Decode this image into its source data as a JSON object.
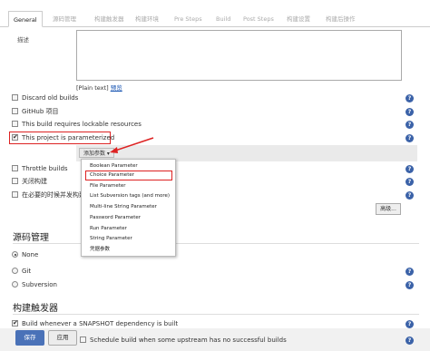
{
  "tabs": [
    "General",
    "源码管理",
    "构建触发器",
    "构建环境",
    "Pre Steps",
    "Build",
    "Post Steps",
    "构建设置",
    "构建后操作"
  ],
  "description": {
    "label": "描述",
    "preview": "[Plain text]",
    "preview_link": "预览"
  },
  "options": [
    {
      "label": "Discard old builds",
      "checked": false
    },
    {
      "label": "GitHub 项目",
      "checked": false
    },
    {
      "label": "This build requires lockable resources",
      "checked": false
    },
    {
      "label": "This project is parameterized",
      "checked": true
    },
    {
      "label": "Throttle builds",
      "checked": false
    },
    {
      "label": "关闭构建",
      "checked": false
    },
    {
      "label": "在必要的时候并发构建",
      "checked": false
    }
  ],
  "add_param_button": "添加参数",
  "param_menu": [
    "Boolean Parameter",
    "Choice Parameter",
    "File Parameter",
    "List Subversion tags (and more)",
    "Multi-line String Parameter",
    "Password Parameter",
    "Run Parameter",
    "String Parameter",
    "凭据参数"
  ],
  "advanced_button": "高级...",
  "scm": {
    "title": "源码管理",
    "options": [
      "None",
      "Git",
      "Subversion"
    ],
    "selected": "None"
  },
  "triggers": {
    "title": "构建触发器",
    "snapshot": "Build whenever a SNAPSHOT dependency is built",
    "upstream": "Schedule build when some upstream has no successful builds"
  },
  "buttons": {
    "save": "保存",
    "apply": "应用"
  },
  "colors": {
    "highlight": "#dd2222",
    "primary": "#4a72b8",
    "help": "#3b62a8"
  }
}
